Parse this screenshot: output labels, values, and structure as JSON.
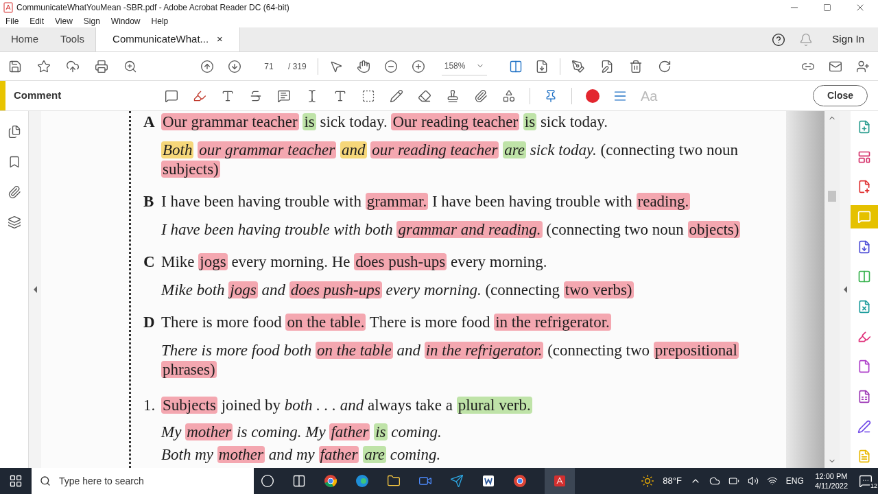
{
  "window": {
    "title": "CommunicateWhatYouMean -SBR.pdf - Adobe Acrobat Reader DC (64-bit)"
  },
  "menu": [
    "File",
    "Edit",
    "View",
    "Sign",
    "Window",
    "Help"
  ],
  "tabs": [
    {
      "label": "Home",
      "selected": false
    },
    {
      "label": "Tools",
      "selected": false
    },
    {
      "label": "CommunicateWhat...",
      "selected": true
    }
  ],
  "close_tab": "×",
  "sign_in": "Sign In",
  "page": {
    "current": "71",
    "total": "/ 319"
  },
  "zoom": "158%",
  "comment_bar": {
    "title": "Comment",
    "font_label": "Aa",
    "close": "Close"
  },
  "document": {
    "lines": [
      {
        "marker": "A",
        "italic": false,
        "segments": [
          {
            "text": "Our grammar teacher",
            "color": "#f4a7b0"
          },
          {
            "text": "is",
            "color": "#bfe3a8"
          },
          {
            "text": "sick today."
          },
          {
            "text": "Our reading teacher",
            "color": "#f4a7b0"
          },
          {
            "text": "is",
            "color": "#bfe3a8"
          },
          {
            "text": "sick today."
          }
        ]
      },
      {
        "italic": true,
        "segments": [
          {
            "text": "Both",
            "color": "#f6d77a"
          },
          {
            "text": "our grammar teacher",
            "color": "#f4a7b0"
          },
          {
            "text": "and",
            "color": "#f6d77a"
          },
          {
            "text": "our reading teacher",
            "color": "#f4a7b0"
          },
          {
            "text": "are",
            "color": "#bfe3a8"
          },
          {
            "text": "sick today."
          }
        ],
        "note": [
          {
            "text": "(connecting two noun"
          },
          {
            "text": "subjects)",
            "color": "#f4a7b0"
          }
        ]
      },
      {
        "marker": "B",
        "italic": false,
        "segments": [
          {
            "text": "I have been having trouble with"
          },
          {
            "text": "grammar.",
            "color": "#f4a7b0"
          },
          {
            "text": "I have been having trouble with"
          },
          {
            "text": "reading.",
            "color": "#f4a7b0"
          }
        ]
      },
      {
        "italic": true,
        "segments": [
          {
            "text": "I have been having trouble with both"
          },
          {
            "text": "grammar and reading.",
            "color": "#f4a7b0"
          }
        ],
        "note": [
          {
            "text": "(connecting two noun"
          },
          {
            "text": "objects)",
            "color": "#f4a7b0"
          }
        ]
      },
      {
        "marker": "C",
        "italic": false,
        "segments": [
          {
            "text": "Mike"
          },
          {
            "text": "jogs",
            "color": "#f4a7b0"
          },
          {
            "text": "every morning. He"
          },
          {
            "text": "does push-ups",
            "color": "#f4a7b0"
          },
          {
            "text": "every morning."
          }
        ]
      },
      {
        "italic": true,
        "segments": [
          {
            "text": "Mike both"
          },
          {
            "text": "jogs",
            "color": "#f4a7b0"
          },
          {
            "text": "and"
          },
          {
            "text": "does push-ups",
            "color": "#f4a7b0"
          },
          {
            "text": "every morning."
          }
        ],
        "note": [
          {
            "text": "(connecting"
          },
          {
            "text": "two verbs)",
            "color": "#f4a7b0"
          }
        ]
      },
      {
        "marker": "D",
        "italic": false,
        "segments": [
          {
            "text": "There is more food"
          },
          {
            "text": "on the table.",
            "color": "#f4a7b0"
          },
          {
            "text": "There is more food"
          },
          {
            "text": "in the refrigerator.",
            "color": "#f4a7b0"
          }
        ]
      },
      {
        "italic": true,
        "segments": [
          {
            "text": "There is more food both"
          },
          {
            "text": "on the table",
            "color": "#f4a7b0"
          },
          {
            "text": "and"
          },
          {
            "text": "in the refrigerator.",
            "color": "#f4a7b0"
          }
        ],
        "note": [
          {
            "text": "(connecting two"
          },
          {
            "text": "prepositional phrases)",
            "color": "#f4a7b0"
          }
        ]
      }
    ],
    "rule": {
      "marker": "1.",
      "segments": [
        {
          "text": "Subjects",
          "color": "#f4a7b0"
        },
        {
          "text": "joined by *both . . . and* always take a"
        },
        {
          "text": "plural verb.",
          "color": "#bfe3a8"
        }
      ]
    },
    "examples": [
      {
        "segments": [
          {
            "text": "My"
          },
          {
            "text": "mother",
            "color": "#f4a7b0"
          },
          {
            "text": "is coming. My"
          },
          {
            "text": "father",
            "color": "#f4a7b0"
          },
          {
            "text": "is",
            "color": "#bfe3a8"
          },
          {
            "text": "coming."
          }
        ]
      },
      {
        "segments": [
          {
            "text": "Both my"
          },
          {
            "text": "mother",
            "color": "#f4a7b0"
          },
          {
            "text": "and my"
          },
          {
            "text": "father",
            "color": "#f4a7b0"
          },
          {
            "text": "are",
            "color": "#bfe3a8"
          },
          {
            "text": "coming."
          }
        ]
      }
    ]
  },
  "right_tools": [
    {
      "color": "#2a9d8f",
      "selected": false
    },
    {
      "color": "#d6336c",
      "selected": false
    },
    {
      "color": "#e03131",
      "selected": false
    },
    {
      "color": "#ffffff",
      "selected": true
    },
    {
      "color": "#4c4cd6",
      "selected": false
    },
    {
      "color": "#37b24d",
      "selected": false
    },
    {
      "color": "#1c9c9c",
      "selected": false
    },
    {
      "color": "#e0307a",
      "selected": false
    },
    {
      "color": "#ae3ec9",
      "selected": false
    },
    {
      "color": "#9c36b5",
      "selected": false
    },
    {
      "color": "#7048e8",
      "selected": false
    },
    {
      "color": "#e8b800",
      "selected": false
    }
  ],
  "taskbar": {
    "search_placeholder": "Type here to search",
    "weather": "88°F",
    "language": "ENG",
    "time": "12:00 PM",
    "date": "4/11/2022",
    "notifications": "12"
  }
}
